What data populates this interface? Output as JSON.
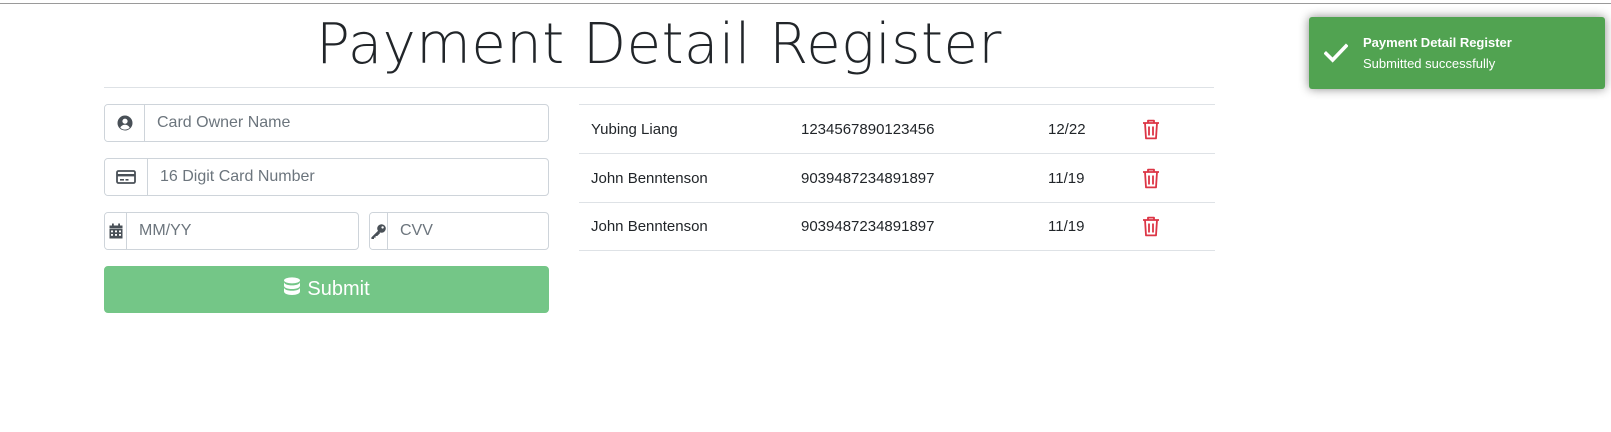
{
  "header": {
    "title": "Payment Detail Register"
  },
  "form": {
    "owner_placeholder": "Card Owner Name",
    "number_placeholder": "16 Digit Card Number",
    "expiry_placeholder": "MM/YY",
    "cvv_placeholder": "CVV",
    "submit_label": "Submit"
  },
  "table": {
    "rows": [
      {
        "name": "Yubing Liang",
        "number": "1234567890123456",
        "expiry": "12/22"
      },
      {
        "name": "John Benntenson",
        "number": "9039487234891897",
        "expiry": "11/19"
      },
      {
        "name": "John Benntenson",
        "number": "9039487234891897",
        "expiry": "11/19"
      }
    ]
  },
  "toast": {
    "title": "Payment Detail Register",
    "message": "Submitted successfully"
  },
  "colors": {
    "submit": "#74c687",
    "toast": "#51a351",
    "delete": "#dc3545"
  },
  "icons": {
    "owner": "user-circle-icon",
    "number": "credit-card-icon",
    "expiry": "calendar-icon",
    "cvv": "key-icon",
    "submit": "database-icon",
    "delete": "trash-icon",
    "toast": "check-icon"
  }
}
